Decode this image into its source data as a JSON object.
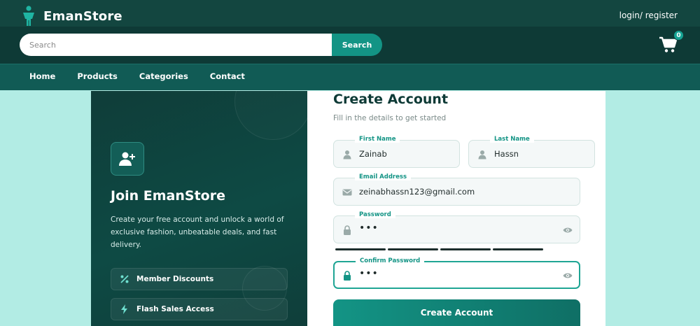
{
  "header": {
    "brand": "EmanStore",
    "auth_link": "login/ register",
    "search": {
      "placeholder": "Search",
      "button_label": "Search"
    },
    "cart": {
      "count": "0"
    }
  },
  "nav": {
    "items": [
      {
        "label": "Home"
      },
      {
        "label": "Products"
      },
      {
        "label": "Categories"
      },
      {
        "label": "Contact"
      }
    ]
  },
  "join_panel": {
    "title": "Join EmanStore",
    "description": "Create your free account and unlock a world of exclusive fashion, unbeatable deals, and fast delivery.",
    "features": [
      {
        "label": "Member Discounts",
        "icon": "percent-icon"
      },
      {
        "label": "Flash Sales Access",
        "icon": "lightning-icon"
      }
    ]
  },
  "form": {
    "title": "Create Account",
    "subtitle": "Fill in the details to get started",
    "first_name": {
      "label": "First Name",
      "value": "Zainab"
    },
    "last_name": {
      "label": "Last Name",
      "value": "Hassn"
    },
    "email": {
      "label": "Email Address",
      "value": "zeinabhassn123@gmail.com"
    },
    "password": {
      "label": "Password",
      "value": "•••"
    },
    "confirm_password": {
      "label": "Confirm Password",
      "value": "•••"
    },
    "submit_label": "Create Account"
  },
  "colors": {
    "header_bg": "#0e3a36",
    "nav_bg": "#115b55",
    "accent": "#139485",
    "page_bg": "#b2ece4"
  }
}
